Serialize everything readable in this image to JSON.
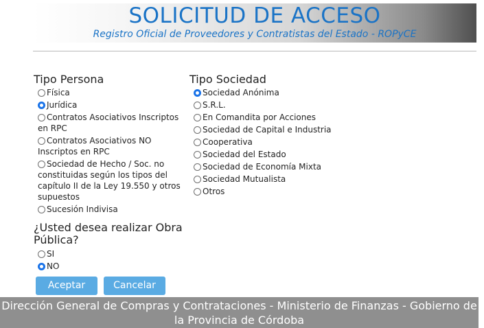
{
  "header": {
    "title": "SOLICITUD DE ACCESO",
    "subtitle": "Registro Oficial de Proveedores y Contratistas del Estado - ROPyCE"
  },
  "tipo_persona": {
    "title": "Tipo Persona",
    "options": [
      {
        "label": "Física",
        "checked": false
      },
      {
        "label": "Jurídica",
        "checked": true
      },
      {
        "label": "Contratos Asociativos Inscriptos en RPC",
        "checked": false
      },
      {
        "label": "Contratos Asociativos NO Inscriptos en RPC",
        "checked": false
      },
      {
        "label": "Sociedad de Hecho / Soc. no constituidas según los tipos del capítulo II de la Ley 19.550 y otros supuestos",
        "checked": false
      },
      {
        "label": "Sucesión Indivisa",
        "checked": false
      }
    ]
  },
  "tipo_sociedad": {
    "title": "Tipo Sociedad",
    "options": [
      {
        "label": "Sociedad Anónima",
        "checked": true
      },
      {
        "label": "S.R.L.",
        "checked": false
      },
      {
        "label": "En Comandita por Acciones",
        "checked": false
      },
      {
        "label": "Sociedad de Capital e Industria",
        "checked": false
      },
      {
        "label": "Cooperativa",
        "checked": false
      },
      {
        "label": "Sociedad del Estado",
        "checked": false
      },
      {
        "label": "Sociedad de Economía Mixta",
        "checked": false
      },
      {
        "label": "Sociedad Mutualista",
        "checked": false
      },
      {
        "label": "Otros",
        "checked": false
      }
    ]
  },
  "obra_publica": {
    "title": "¿Usted desea realizar Obra Pública?",
    "options": [
      {
        "label": "SI",
        "checked": false
      },
      {
        "label": "NO",
        "checked": true
      }
    ]
  },
  "buttons": {
    "accept": "Aceptar",
    "cancel": "Cancelar"
  },
  "footer": {
    "text": "Dirección General de Compras y Contrataciones - Ministerio de Finanzas - Gobierno de la Provincia de Córdoba"
  },
  "colors": {
    "accent": "#1a73c6",
    "button": "#5aabe3",
    "footer_bg": "#8f8f8f"
  }
}
